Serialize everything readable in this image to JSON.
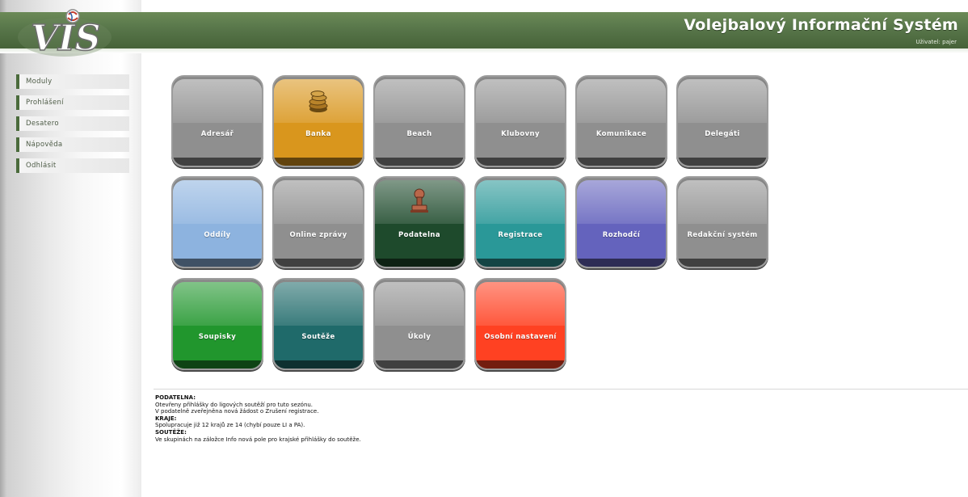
{
  "header": {
    "logo_text": "VIS",
    "title": "Volejbalový Informační Systém",
    "user_label": "Uživatel: pajer"
  },
  "sidebar": {
    "items": [
      {
        "label": "Moduly"
      },
      {
        "label": "Prohlášení"
      },
      {
        "label": "Desatero"
      },
      {
        "label": "Nápověda"
      },
      {
        "label": "Odhlásit"
      }
    ]
  },
  "tiles": [
    {
      "label": "Adresář",
      "color": "#8f8f8f"
    },
    {
      "label": "Banka",
      "color": "#d9961d",
      "icon": "coins-icon"
    },
    {
      "label": "Beach",
      "color": "#8f8f8f"
    },
    {
      "label": "Klubovny",
      "color": "#8f8f8f"
    },
    {
      "label": "Komunikace",
      "color": "#8f8f8f"
    },
    {
      "label": "Delegáti",
      "color": "#8f8f8f"
    },
    {
      "label": "Oddíly",
      "color": "#8db3df"
    },
    {
      "label": "Online zprávy",
      "color": "#8f8f8f"
    },
    {
      "label": "Podatelna",
      "color": "#1e4a2c",
      "icon": "stamp-icon"
    },
    {
      "label": "Registrace",
      "color": "#2a9898"
    },
    {
      "label": "Rozhodčí",
      "color": "#6463bd"
    },
    {
      "label": "Redakční systém",
      "color": "#8f8f8f"
    },
    {
      "label": "Soupisky",
      "color": "#21962d"
    },
    {
      "label": "Soutěže",
      "color": "#1f6a6a"
    },
    {
      "label": "Úkoly",
      "color": "#8f8f8f"
    },
    {
      "label": "Osobní nastavení",
      "color": "#ff4122"
    }
  ],
  "news": {
    "lines": [
      {
        "text": "PODATELNA:",
        "bold": true
      },
      {
        "text": "Otevřeny přihlášky do ligových soutěží pro tuto sezónu.",
        "bold": false
      },
      {
        "text": "V podatelně zveřejněna nová žádost o Zrušení registrace.",
        "bold": false
      },
      {
        "text": "KRAJE:",
        "bold": true
      },
      {
        "text": "Spolupracuje již 12 krajů ze 14 (chybí pouze LI a PA).",
        "bold": false
      },
      {
        "text": "SOUTĚŽE:",
        "bold": true
      },
      {
        "text": "Ve skupinách na záložce Info nová pole pro krajské přihlášky do soutěže.",
        "bold": false
      }
    ]
  }
}
